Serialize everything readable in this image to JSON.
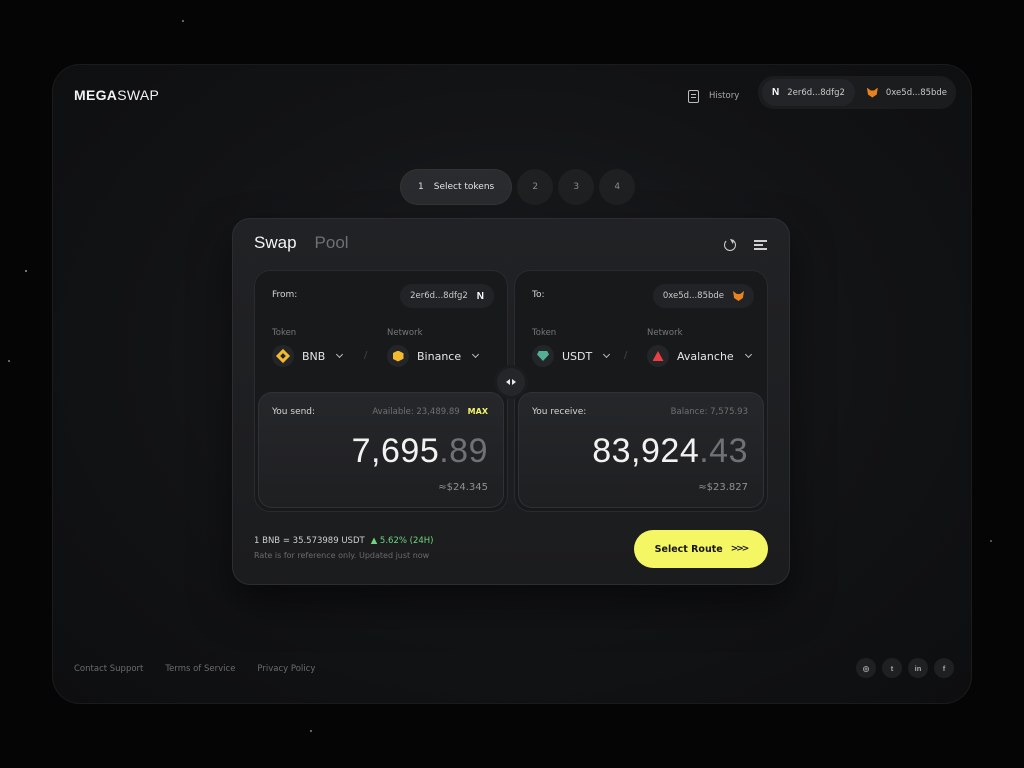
{
  "header": {
    "logo_bold": "MEGA",
    "logo_light": "SWAP",
    "history_label": "History",
    "wallets": [
      {
        "address": "2er6d...8dfg2",
        "icon": "n-icon"
      },
      {
        "address": "0xe5d...85bde",
        "icon": "fox-icon"
      }
    ]
  },
  "steps": [
    {
      "number": "1",
      "label": "Select tokens",
      "active": true
    },
    {
      "number": "2"
    },
    {
      "number": "3"
    },
    {
      "number": "4"
    }
  ],
  "card": {
    "tabs": [
      "Swap",
      "Pool"
    ],
    "from": {
      "heading": "From:",
      "address": "2er6d...8dfg2",
      "token_label": "Token",
      "token": "BNB",
      "network_label": "Network",
      "network": "Binance",
      "amount_label": "You send:",
      "available": "Available: 23,489.89",
      "max": "MAX",
      "amount_int": "7,695",
      "amount_dec": ".89",
      "usd": "≈$24.345"
    },
    "to": {
      "heading": "To:",
      "address": "0xe5d...85bde",
      "token_label": "Token",
      "token": "USDT",
      "network_label": "Network",
      "network": "Avalanche",
      "amount_label": "You receive:",
      "balance": "Balance: 7,575.93",
      "amount_int": "83,924",
      "amount_dec": ".43",
      "usd": "≈$23.827"
    },
    "rate": {
      "text": "1 BNB = 35.573989 USDT",
      "change": "▲ 5.62% (24H)",
      "note": "Rate is for reference only. Updated just now"
    },
    "route_button": "Select Route",
    "route_chevrons": ">>>"
  },
  "footer": {
    "links": [
      "Contact Support",
      "Terms of Service",
      "Privacy Policy"
    ],
    "socials": [
      {
        "icon": "instagram-icon",
        "glyph": "◎"
      },
      {
        "icon": "twitter-icon",
        "glyph": "t"
      },
      {
        "icon": "linkedin-icon",
        "glyph": "in"
      },
      {
        "icon": "facebook-icon",
        "glyph": "f"
      }
    ]
  },
  "colors": {
    "accent": "#f4f664",
    "positive": "#6fd67e",
    "bnb": "#f3ba2f",
    "usdt": "#50af95",
    "avax": "#e84142",
    "metamask": "#e8821e"
  }
}
